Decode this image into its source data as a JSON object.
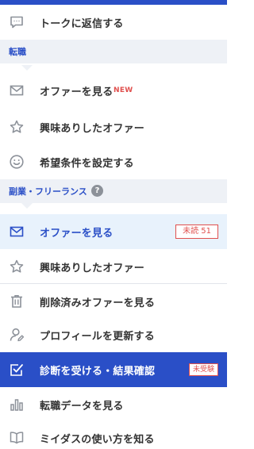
{
  "colors": {
    "accent": "#2a4fc7",
    "section_bg": "#eef1f6",
    "active_bg": "#e8f2fc",
    "badge_red": "#e0504e",
    "icon_gray": "#8c9199"
  },
  "top_items": [
    {
      "label": "トークに返信する",
      "icon": "chat-bubble-icon"
    }
  ],
  "sections": {
    "career": {
      "title": "転職"
    },
    "side": {
      "title": "副業・フリーランス",
      "help": "?"
    }
  },
  "career_items": [
    {
      "label": "オファーを見る",
      "icon": "mail-icon",
      "badge": "NEW"
    },
    {
      "label": "興味ありしたオファー",
      "icon": "star-icon"
    },
    {
      "label": "希望条件を設定する",
      "icon": "smile-icon"
    }
  ],
  "side_items": [
    {
      "label": "オファーを見る",
      "icon": "mail-icon",
      "badge": "未読 51"
    },
    {
      "label": "興味ありしたオファー",
      "icon": "star-icon"
    }
  ],
  "bottom_items": [
    {
      "label": "削除済みオファーを見る",
      "icon": "trash-icon"
    },
    {
      "label": "プロフィールを更新する",
      "icon": "profile-edit-icon"
    },
    {
      "label": "診断を受ける・結果確認",
      "icon": "checkbox-icon",
      "badge": "未受験"
    },
    {
      "label": "転職データを見る",
      "icon": "bar-chart-icon"
    },
    {
      "label": "ミイダスの使い方を知る",
      "icon": "book-icon"
    }
  ]
}
